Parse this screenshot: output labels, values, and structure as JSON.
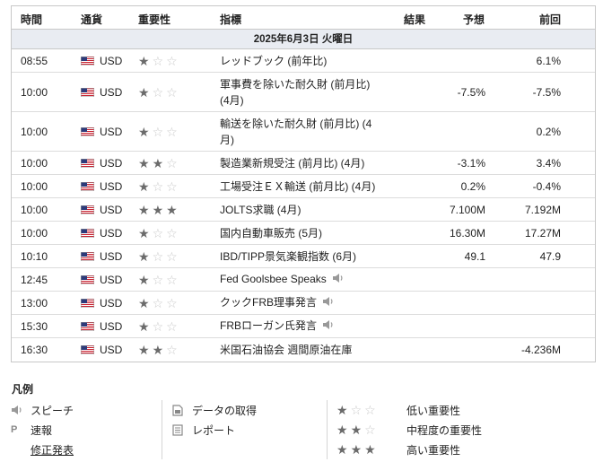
{
  "header": {
    "time": "時間",
    "currency": "通貨",
    "importance": "重要性",
    "indicator": "指標",
    "actual": "結果",
    "forecast": "予想",
    "previous": "前回"
  },
  "date_label": "2025年6月3日 火曜日",
  "rows": [
    {
      "time": "08:55",
      "currency": "USD",
      "stars": 1,
      "indicator": "レッドブック (前年比)",
      "actual": "",
      "forecast": "",
      "previous": "6.1%"
    },
    {
      "time": "10:00",
      "currency": "USD",
      "stars": 1,
      "indicator": "軍事費を除いた耐久財 (前月比) (4月)",
      "actual": "",
      "forecast": "-7.5%",
      "previous": "-7.5%"
    },
    {
      "time": "10:00",
      "currency": "USD",
      "stars": 1,
      "indicator": "輸送を除いた耐久財 (前月比) (4月)",
      "actual": "",
      "forecast": "",
      "previous": "0.2%"
    },
    {
      "time": "10:00",
      "currency": "USD",
      "stars": 2,
      "indicator": "製造業新規受注 (前月比) (4月)",
      "actual": "",
      "forecast": "-3.1%",
      "previous": "3.4%"
    },
    {
      "time": "10:00",
      "currency": "USD",
      "stars": 1,
      "indicator": "工場受注ＥＸ輸送 (前月比) (4月)",
      "actual": "",
      "forecast": "0.2%",
      "previous": "-0.4%"
    },
    {
      "time": "10:00",
      "currency": "USD",
      "stars": 3,
      "indicator": "JOLTS求職 (4月)",
      "actual": "",
      "forecast": "7.100M",
      "previous": "7.192M"
    },
    {
      "time": "10:00",
      "currency": "USD",
      "stars": 1,
      "indicator": "国内自動車販売 (5月)",
      "actual": "",
      "forecast": "16.30M",
      "previous": "17.27M"
    },
    {
      "time": "10:10",
      "currency": "USD",
      "stars": 1,
      "indicator": "IBD/TIPP景気楽観指数 (6月)",
      "actual": "",
      "forecast": "49.1",
      "previous": "47.9"
    },
    {
      "time": "12:45",
      "currency": "USD",
      "stars": 1,
      "indicator": "Fed Goolsbee Speaks",
      "actual": "",
      "forecast": "",
      "previous": "",
      "speech": true
    },
    {
      "time": "13:00",
      "currency": "USD",
      "stars": 1,
      "indicator": "クックFRB理事発言",
      "actual": "",
      "forecast": "",
      "previous": "",
      "speech": true
    },
    {
      "time": "15:30",
      "currency": "USD",
      "stars": 1,
      "indicator": "FRBローガン氏発言",
      "actual": "",
      "forecast": "",
      "previous": "",
      "speech": true
    },
    {
      "time": "16:30",
      "currency": "USD",
      "stars": 2,
      "indicator": "米国石油協会 週間原油在庫",
      "actual": "",
      "forecast": "",
      "previous": "-4.236M"
    }
  ],
  "legend": {
    "title": "凡例",
    "col1": [
      {
        "icon": "speaker-icon",
        "label": "スピーチ"
      },
      {
        "icon": "preliminary-icon",
        "glyph": "P",
        "label": "速報"
      },
      {
        "icon": "",
        "label": "修正発表"
      }
    ],
    "col2": [
      {
        "icon": "data-download-icon",
        "label": "データの取得"
      },
      {
        "icon": "report-icon",
        "label": "レポート"
      }
    ],
    "col3": [
      {
        "stars": 1,
        "label": "低い重要性"
      },
      {
        "stars": 2,
        "label": "中程度の重要性"
      },
      {
        "stars": 3,
        "label": "高い重要性"
      }
    ]
  },
  "colors": {
    "date_row_bg": "#e9ecf2",
    "star_on": "#6b6b6b",
    "star_off": "#c9c9c9",
    "border": "#c8c8c8"
  }
}
